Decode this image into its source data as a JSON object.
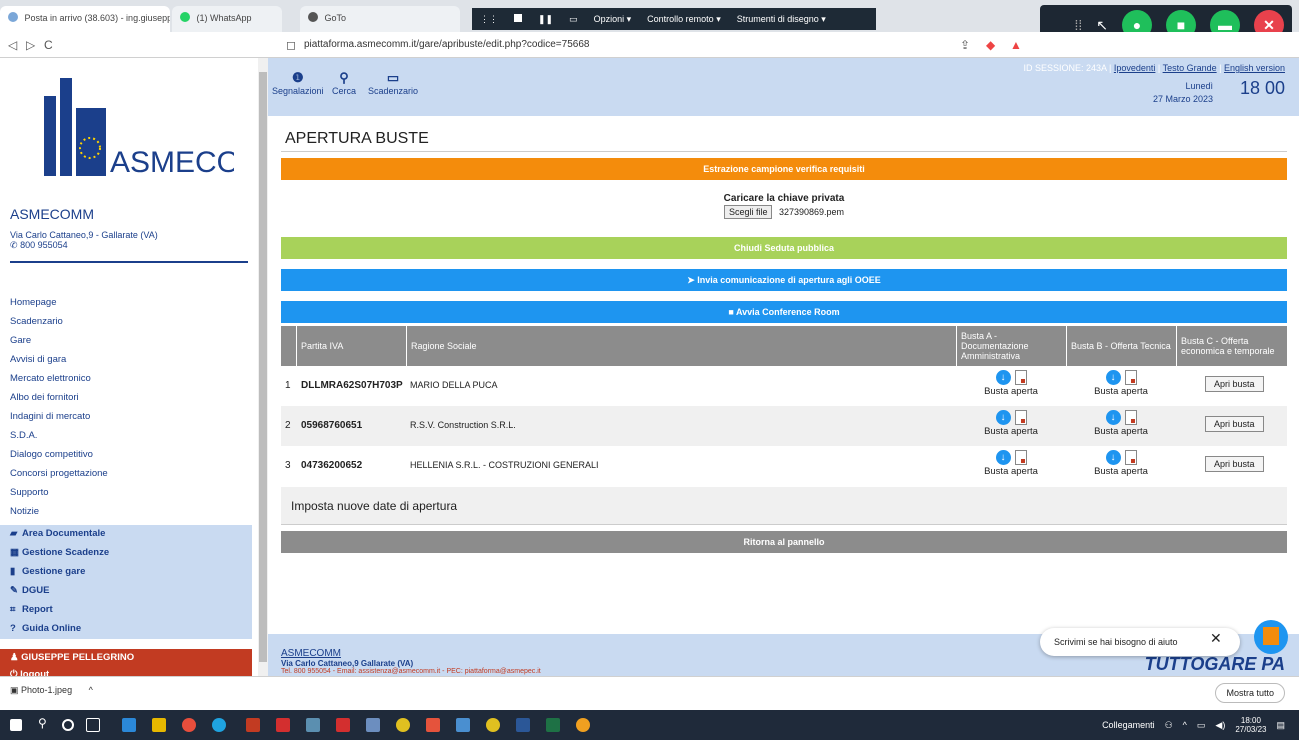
{
  "browser": {
    "tabs": [
      {
        "label": "Posta in arrivo (38.603) - ing.giusepp..."
      },
      {
        "label": "(1) WhatsApp"
      },
      {
        "label": "GoTo"
      }
    ],
    "remote_menu": [
      "Opzioni",
      "Controllo remoto",
      "Strumenti di disegno"
    ],
    "url": "piattaforma.asmecomm.it/gare/apribuste/edit.php?codice=75668"
  },
  "sidebar": {
    "logo_text": "ASMECOMM",
    "org_name": "ASMECOMM",
    "address": "Via Carlo Cattaneo,9 - Gallarate (VA)",
    "phone": "800 955054",
    "menu": [
      "Homepage",
      "Scadenzario",
      "Gare",
      "Avvisi di gara",
      "Mercato elettronico",
      "Albo dei fornitori",
      "Indagini di mercato",
      "S.D.A.",
      "Dialogo competitivo",
      "Concorsi progettazione",
      "Supporto",
      "Notizie"
    ],
    "sections": [
      "Area Documentale",
      "Gestione Scadenze",
      "Gestione gare",
      "DGUE",
      "Report",
      "Guida Online"
    ],
    "user": "GIUSEPPE PELLEGRINO",
    "logout": "logout"
  },
  "topbar": {
    "items": [
      "Segnalazioni",
      "Cerca",
      "Scadenzario"
    ],
    "session_label": "ID SESSIONE: 243A",
    "links": [
      "Ipovedenti",
      "Testo Grande",
      "English version"
    ],
    "day": "Lunedì",
    "date": "27 Marzo 2023",
    "time": "18 00"
  },
  "main": {
    "title": "APERTURA BUSTE",
    "orange_bar": "Estrazione campione verifica requisiti",
    "key_label": "Caricare la chiave privata",
    "file_button": "Scegli file",
    "file_name": "327390869.pem",
    "green_bar": "Chiudi Seduta pubblica",
    "blue_bar1": "Invia comunicazione di apertura agli OOEE",
    "blue_bar2": "Avvia Conference Room",
    "table": {
      "headers": [
        "Partita IVA",
        "Ragione Sociale",
        "Busta A - Documentazione Amministrativa",
        "Busta B - Offerta Tecnica",
        "Busta C - Offerta economica e temporale"
      ],
      "rows": [
        {
          "num": "1",
          "piva": "DLLMRA62S07H703P",
          "ragione": "MARIO DELLA PUCA",
          "busta_a": "Busta aperta",
          "busta_b": "Busta aperta",
          "busta_c": "Apri busta"
        },
        {
          "num": "2",
          "piva": "05968760651",
          "ragione": "R.S.V. Construction S.R.L.",
          "busta_a": "Busta aperta",
          "busta_b": "Busta aperta",
          "busta_c": "Apri busta"
        },
        {
          "num": "3",
          "piva": "04736200652",
          "ragione": "HELLENIA S.R.L. - COSTRUZIONI GENERALI",
          "busta_a": "Busta aperta",
          "busta_b": "Busta aperta",
          "busta_c": "Apri busta"
        }
      ]
    },
    "date_row": "Imposta nuove date di apertura",
    "gray_bar": "Ritorna al pannello"
  },
  "footer": {
    "name": "ASMECOMM",
    "address": "Via Carlo Cattaneo,9 Gallarate (VA)",
    "contact": "Tel. 800 955054 - Email: assistenza@asmecomm.it - PEC: piattaforma@asmepec.it",
    "brand": "TUTTOGARE PA"
  },
  "chat": {
    "placeholder": "Scrivimi se hai bisogno di aiuto"
  },
  "downloads": {
    "file": "Photo-1.jpeg",
    "show_all": "Mostra tutto"
  },
  "taskbar": {
    "tray_label": "Collegamenti",
    "time": "18:00",
    "date": "27/03/23"
  }
}
